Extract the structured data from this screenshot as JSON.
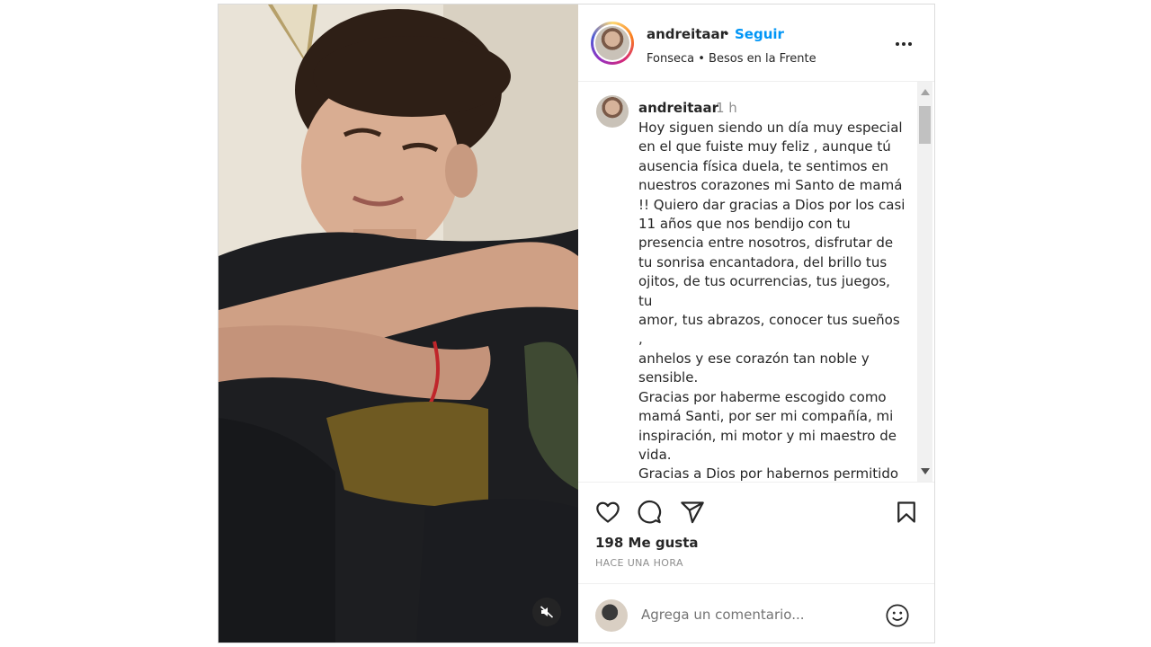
{
  "post": {
    "author": "andreitaar",
    "separator": "•",
    "follow_label": "Seguir",
    "audio": {
      "artist": "Fonseca",
      "separator": "•",
      "song": "Besos en la Frente"
    },
    "caption_time": "1 h",
    "caption": "Hoy siguen siendo un día muy especial\nen el que fuiste muy feliz , aunque tú\nausencia física duela, te sentimos en\nnuestros corazones mi Santo de mamá\n!! Quiero dar gracias a Dios por los casi\n11 años que nos bendijo con tu\npresencia entre nosotros, disfrutar de\ntu sonrisa encantadora, del brillo tus\nojitos, de tus ocurrencias, tus juegos, tu\namor, tus abrazos, conocer tus sueños ,\nanhelos y ese corazón tan noble y\nsensible.\nGracias por haberme escogido como\nmamá Santi, por ser mi compañía, mi\ninspiración, mi motor y mi maestro de\nvida.\nGracias a Dios por habernos permitido\nser tu apoyo y caminar a tu lado, por\nser parte del proposito que tenia para",
    "likes": "198 Me gusta",
    "timestamp": "HACE UNA HORA",
    "comment_placeholder": "Agrega un comentario..."
  },
  "icons": {
    "mute": "speaker-muted-icon",
    "more": "more-options-icon",
    "like": "heart-icon",
    "comment": "comment-bubble-icon",
    "share": "paper-plane-icon",
    "save": "bookmark-icon",
    "emoji": "smiley-icon"
  },
  "colors": {
    "accent": "#0095f6",
    "text": "#262626",
    "muted": "#8e8e8e",
    "border": "#dbdbdb"
  }
}
